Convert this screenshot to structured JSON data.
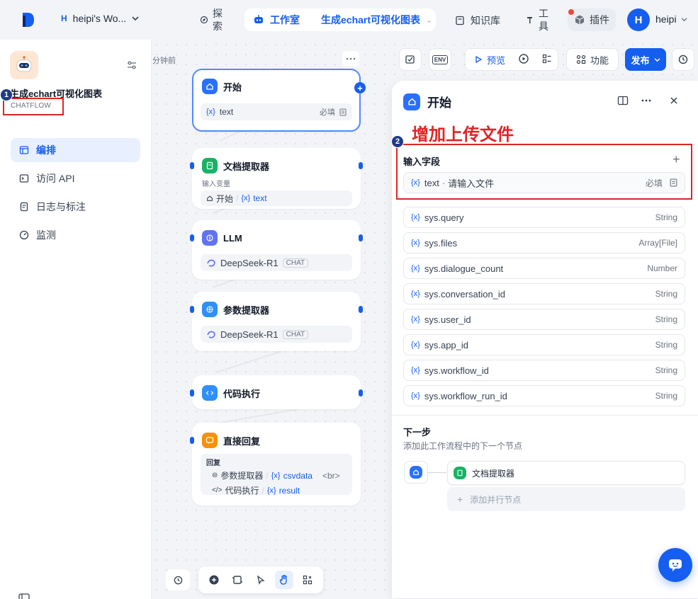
{
  "topbar": {
    "workspace_initial": "H",
    "workspace_name": "heipi's Wo...",
    "explore_label": "探索",
    "studio_label": "工作室",
    "current_app": "生成echart可视化图表",
    "knowledge_label": "知识库",
    "tools_label": "工具",
    "plugins_label": "插件",
    "user_initial": "H",
    "user_name": "heipi"
  },
  "sidebar": {
    "app_name": "生成echart可视化图表",
    "app_type": "CHATFLOW",
    "items": [
      {
        "label": "编排",
        "icon": "layout-icon",
        "active": true
      },
      {
        "label": "访问 API",
        "icon": "terminal-icon",
        "active": false
      },
      {
        "label": "日志与标注",
        "icon": "log-icon",
        "active": false
      },
      {
        "label": "监测",
        "icon": "gauge-icon",
        "active": false
      }
    ]
  },
  "annotations": {
    "badge1": "1",
    "badge2": "2",
    "text": "增加上传文件"
  },
  "canvas": {
    "time_ago": "分钟前",
    "nodes": {
      "start": {
        "title": "开始",
        "var": "text",
        "required": "必填"
      },
      "doc_extractor": {
        "title": "文档提取器",
        "sub": "输入变量",
        "src_node": "开始",
        "src_var": "text"
      },
      "llm": {
        "title": "LLM",
        "model": "DeepSeek-R1",
        "tag": "CHAT"
      },
      "param_extractor": {
        "title": "参数提取器",
        "model": "DeepSeek-R1",
        "tag": "CHAT"
      },
      "code": {
        "title": "代码执行"
      },
      "answer": {
        "title": "直接回复",
        "sub": "回复",
        "line1_node": "参数提取器",
        "line1_var": "csvdata",
        "line1_extra": "<br>",
        "line2_node": "代码执行",
        "line2_var": "result"
      }
    }
  },
  "toolbar": {
    "env_label": "ENV",
    "preview_label": "预览",
    "features_label": "功能",
    "publish_label": "发布"
  },
  "panel": {
    "title": "开始",
    "section_label": "输入字段",
    "input_field": {
      "name": "text",
      "placeholder": "请输入文件",
      "required": "必填"
    },
    "sys_fields": [
      {
        "name": "sys.query",
        "type": "String"
      },
      {
        "name": "sys.files",
        "type": "Array[File]"
      },
      {
        "name": "sys.dialogue_count",
        "type": "Number"
      },
      {
        "name": "sys.conversation_id",
        "type": "String"
      },
      {
        "name": "sys.user_id",
        "type": "String"
      },
      {
        "name": "sys.app_id",
        "type": "String"
      },
      {
        "name": "sys.workflow_id",
        "type": "String"
      },
      {
        "name": "sys.workflow_run_id",
        "type": "String"
      }
    ],
    "next_title": "下一步",
    "next_desc": "添加此工作流程中的下一个节点",
    "next_node": "文档提取器",
    "add_parallel": "添加并行节点"
  },
  "colors": {
    "accent": "#155eef",
    "annotation": "#e02424"
  }
}
